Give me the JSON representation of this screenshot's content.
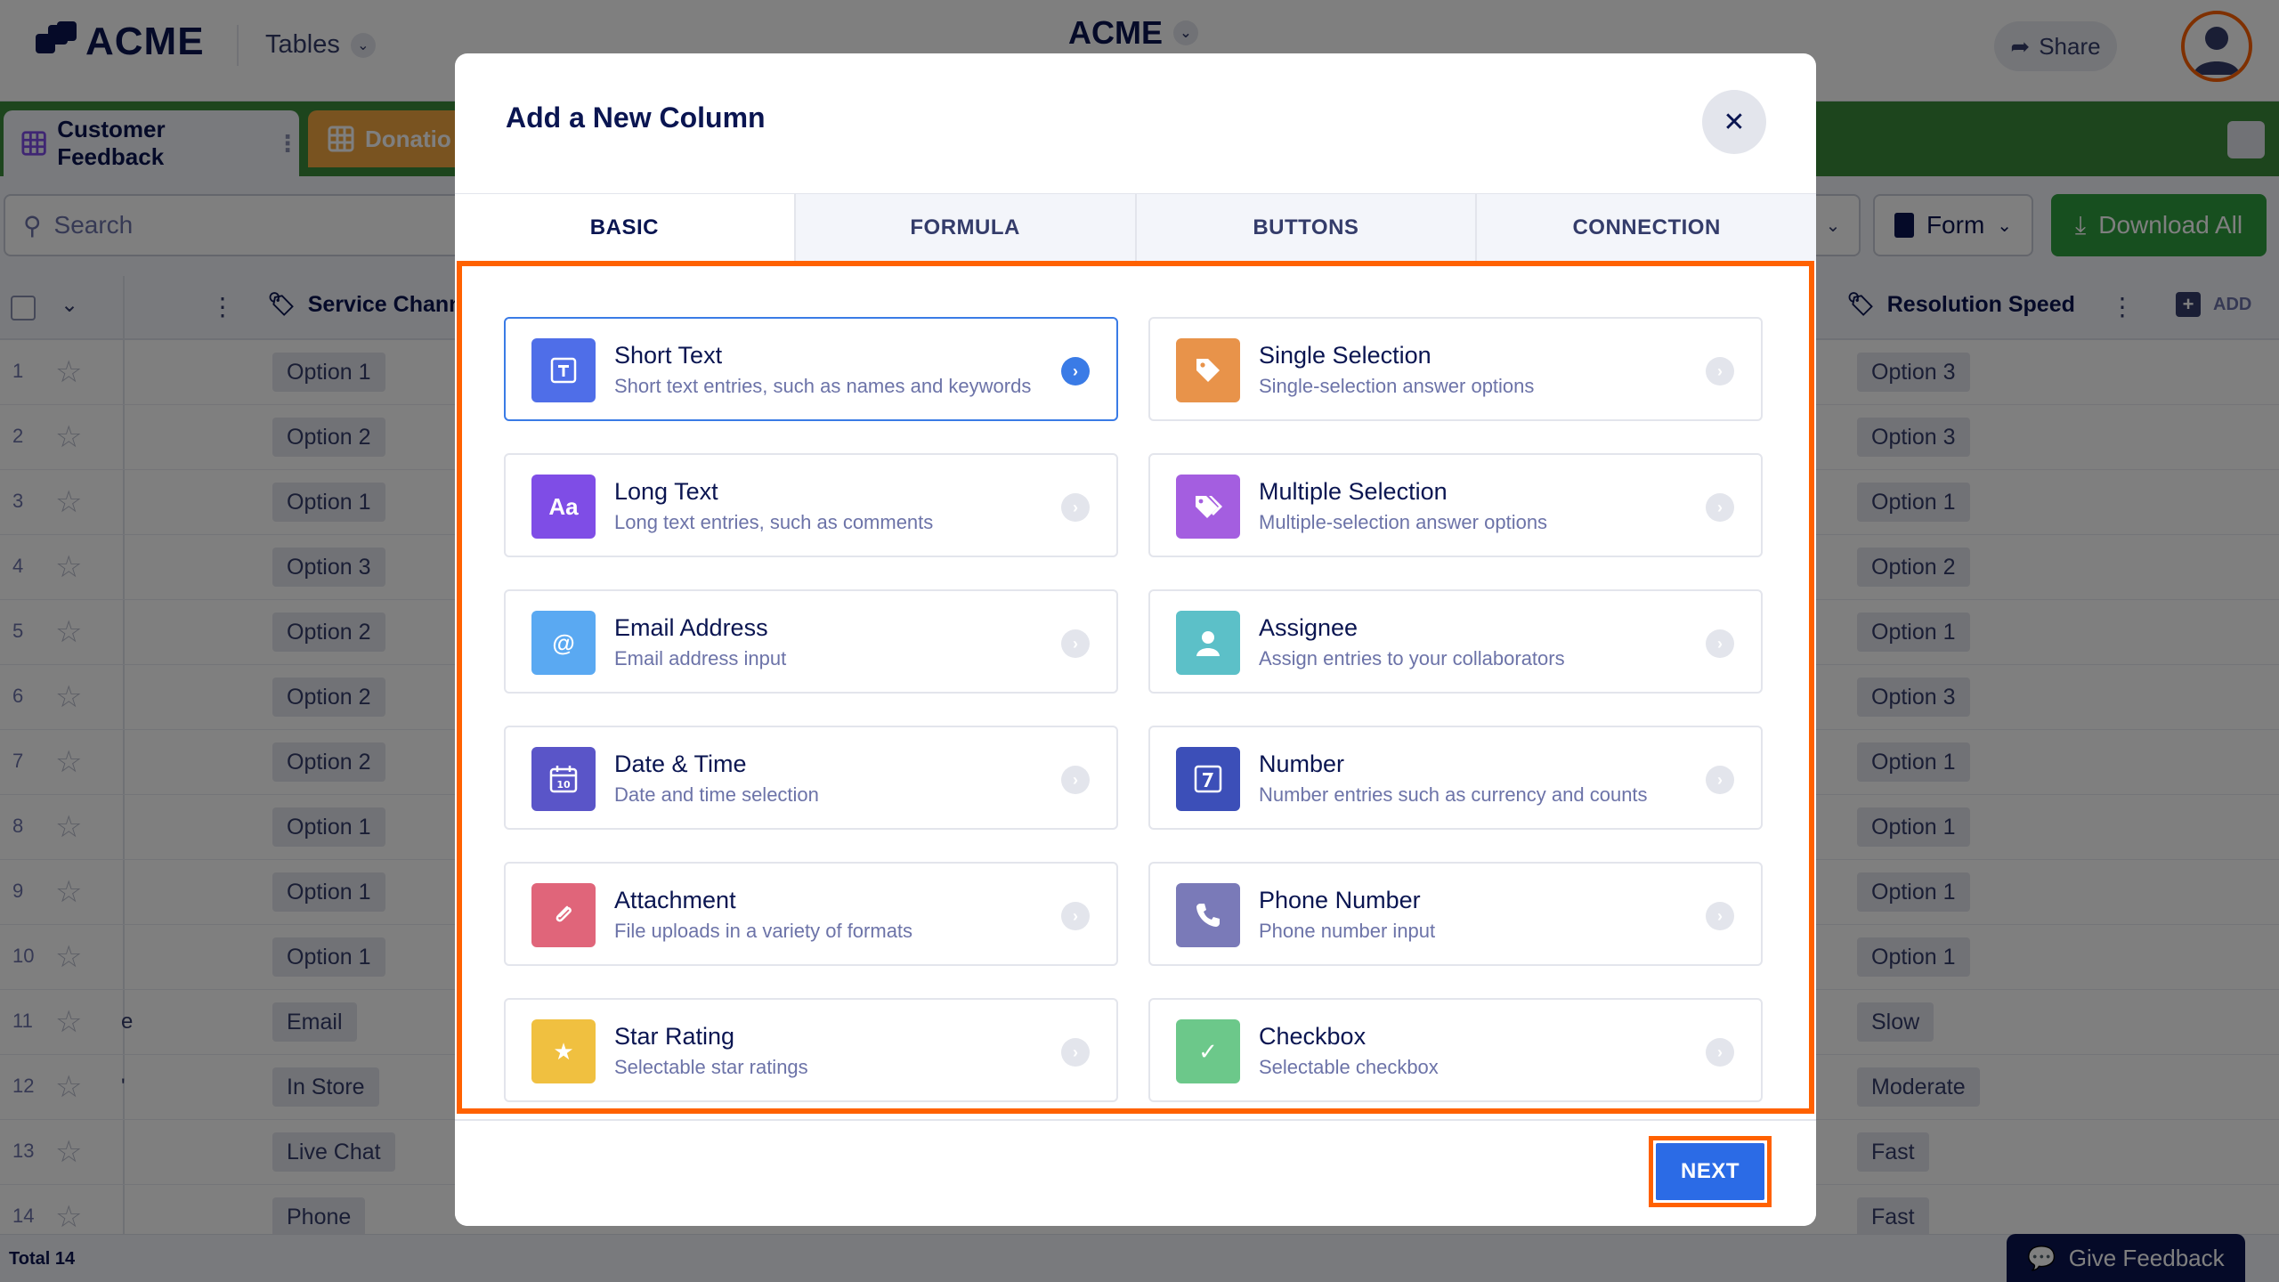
{
  "app": {
    "brand": "ACME",
    "section_dropdown": "Tables",
    "center_title": "ACME",
    "share_label": "Share"
  },
  "sheet_tabs": [
    {
      "label": "Customer Feedback",
      "active": true
    },
    {
      "label": "Donatio",
      "active": false
    }
  ],
  "toolbar": {
    "search_placeholder": "Search",
    "form_label": "Form",
    "download_label": "Download All"
  },
  "grid": {
    "columns": [
      "Service Chann",
      "Resolution Speed"
    ],
    "add_label": "ADD",
    "rows": [
      {
        "num": "1",
        "left_stub": "",
        "service": "Option 1",
        "speed": "Option 3"
      },
      {
        "num": "2",
        "left_stub": "",
        "service": "Option 2",
        "speed": "Option 3"
      },
      {
        "num": "3",
        "left_stub": "",
        "service": "Option 1",
        "speed": "Option 1"
      },
      {
        "num": "4",
        "left_stub": "",
        "service": "Option 3",
        "speed": "Option 2"
      },
      {
        "num": "5",
        "left_stub": "",
        "service": "Option 2",
        "speed": "Option 1"
      },
      {
        "num": "6",
        "left_stub": "",
        "service": "Option 2",
        "speed": "Option 3"
      },
      {
        "num": "7",
        "left_stub": "",
        "service": "Option 2",
        "speed": "Option 1"
      },
      {
        "num": "8",
        "left_stub": "",
        "service": "Option 1",
        "speed": "Option 1"
      },
      {
        "num": "9",
        "left_stub": "",
        "service": "Option 1",
        "speed": "Option 1"
      },
      {
        "num": "10",
        "left_stub": "",
        "service": "Option 1",
        "speed": "Option 1"
      },
      {
        "num": "11",
        "left_stub": "e",
        "service": "Email",
        "speed": "Slow"
      },
      {
        "num": "12",
        "left_stub": "'",
        "service": "In Store",
        "speed": "Moderate"
      },
      {
        "num": "13",
        "left_stub": "",
        "service": "Live Chat",
        "speed": "Fast"
      },
      {
        "num": "14",
        "left_stub": "",
        "service": "Phone",
        "speed": "Fast"
      }
    ],
    "total_label": "Total 14"
  },
  "feedback_button": "Give Feedback",
  "modal": {
    "title": "Add a New Column",
    "tabs": [
      "BASIC",
      "FORMULA",
      "BUTTONS",
      "CONNECTION"
    ],
    "active_tab": "BASIC",
    "types": [
      {
        "name": "Short Text",
        "desc": "Short text entries, such as names and keywords",
        "icon": "T",
        "icon_name": "short-text-icon",
        "color": "#4f6ee8",
        "selected": true
      },
      {
        "name": "Single Selection",
        "desc": "Single-selection answer options",
        "icon": "tag",
        "icon_name": "tag-icon",
        "color": "#e8934a",
        "selected": false
      },
      {
        "name": "Long Text",
        "desc": "Long text entries, such as comments",
        "icon": "Aa",
        "icon_name": "long-text-icon",
        "color": "#7f4de6",
        "selected": false
      },
      {
        "name": "Multiple Selection",
        "desc": "Multiple-selection answer options",
        "icon": "tags",
        "icon_name": "tags-icon",
        "color": "#a45ee0",
        "selected": false
      },
      {
        "name": "Email Address",
        "desc": "Email address input",
        "icon": "@",
        "icon_name": "at-icon",
        "color": "#5aa9f2",
        "selected": false
      },
      {
        "name": "Assignee",
        "desc": "Assign entries to your collaborators",
        "icon": "user",
        "icon_name": "user-icon",
        "color": "#5cc0c8",
        "selected": false
      },
      {
        "name": "Date & Time",
        "desc": "Date and time selection",
        "icon": "10",
        "icon_name": "calendar-icon",
        "color": "#5a55c8",
        "selected": false
      },
      {
        "name": "Number",
        "desc": "Number entries such as currency and counts",
        "icon": "7",
        "icon_name": "number-icon",
        "color": "#3c4fb8",
        "selected": false
      },
      {
        "name": "Attachment",
        "desc": "File uploads in a variety of formats",
        "icon": "clip",
        "icon_name": "paperclip-icon",
        "color": "#e0657a",
        "selected": false
      },
      {
        "name": "Phone Number",
        "desc": "Phone number input",
        "icon": "phone",
        "icon_name": "phone-icon",
        "color": "#7a7ab8",
        "selected": false
      },
      {
        "name": "Star Rating",
        "desc": "Selectable star ratings",
        "icon": "★",
        "icon_name": "star-icon",
        "color": "#f0c040",
        "selected": false
      },
      {
        "name": "Checkbox",
        "desc": "Selectable checkbox",
        "icon": "✓",
        "icon_name": "checkbox-icon",
        "color": "#6cc88a",
        "selected": false
      }
    ],
    "next_label": "NEXT"
  },
  "colors": {
    "accent": "#2b6be6",
    "highlight": "#ff6100",
    "navy": "#0a1551",
    "tabbar": "#3b8a3b"
  }
}
